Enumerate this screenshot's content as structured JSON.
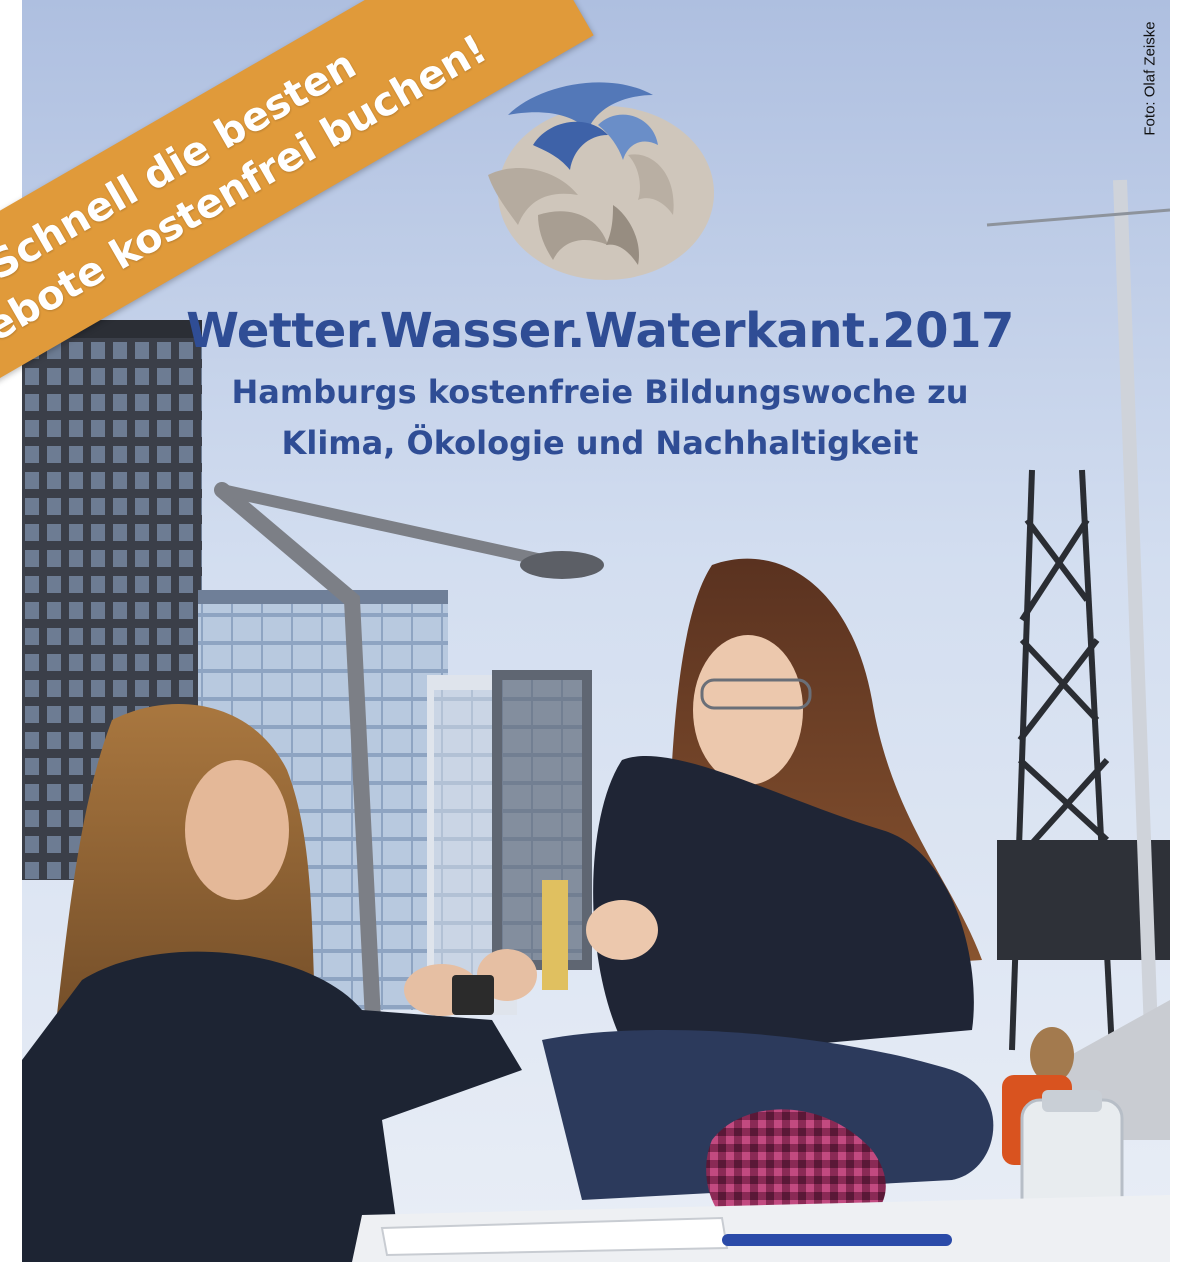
{
  "ribbon": {
    "line1": "Schnell die besten",
    "line2": "Angebote kostenfrei buchen!"
  },
  "photo_credit": "Foto: Olaf Zeiske",
  "title": "Wetter.Wasser.Waterkant.2017",
  "subtitle_line1": "Hamburgs kostenfreie Bildungswoche zu",
  "subtitle_line2": "Klima, Ökologie und Nachhaltigkeit",
  "colors": {
    "title_blue": "#2f4d95",
    "ribbon_orange": "#e09a3a",
    "sky": "#c9d6ea",
    "logo_blue": "#5378b8",
    "logo_stone": "#cfc6bb"
  }
}
